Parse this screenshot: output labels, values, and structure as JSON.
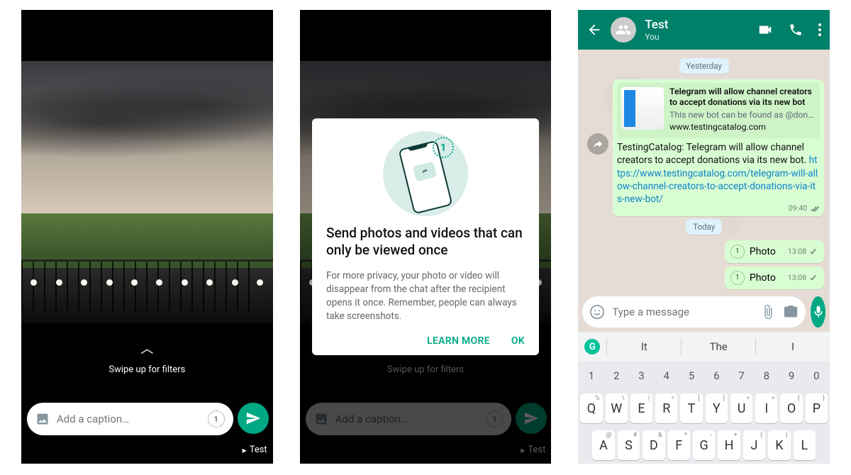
{
  "screen1": {
    "swipe_hint": "Swipe up for filters",
    "caption_placeholder": "Add a caption…",
    "view_once_glyph": "1",
    "recipient": "Test"
  },
  "screen2": {
    "swipe_hint": "Swipe up for filters",
    "caption_placeholder": "Add a caption…",
    "view_once_glyph": "1",
    "recipient": "Test",
    "dialog": {
      "one_glyph": "1",
      "title": "Send photos and videos that can only be viewed once",
      "body": "For more privacy, your photo or video will disappear from the chat after the recipient opens it once. Remember, people can always take screenshots.",
      "learn_more": "LEARN MORE",
      "ok": "OK"
    }
  },
  "screen3": {
    "header": {
      "title": "Test",
      "subtitle": "You"
    },
    "chips": {
      "yesterday": "Yesterday",
      "today": "Today"
    },
    "linked": {
      "card_title": "Telegram will allow channel creators to accept donations via its new bot",
      "card_desc": "This new bot can be found as @don…",
      "card_site": "www.testingcatalog.com",
      "body_text": "TestingCatalog: Telegram will allow channel creators to accept donations via its new bot. ",
      "body_link": "https://www.testingcatalog.com/telegram-will-allow-channel-creators-to-accept-donations-via-its-new-bot/",
      "time": "09:40"
    },
    "photo_msgs": [
      {
        "label": "Photo",
        "time": "13:08"
      },
      {
        "label": "Photo",
        "time": "13:08"
      }
    ],
    "input_placeholder": "Type a message",
    "keyboard": {
      "suggestions": [
        "It",
        "The",
        "I"
      ],
      "num_row": [
        "1",
        "2",
        "3",
        "4",
        "5",
        "6",
        "7",
        "8",
        "9",
        "0"
      ],
      "row1": [
        "Q",
        "W",
        "E",
        "R",
        "T",
        "Y",
        "U",
        "I",
        "O",
        "P"
      ],
      "row1_sup": [
        "%",
        "\\",
        "|",
        "=",
        "[",
        "]",
        "<",
        ">",
        "{",
        "}"
      ],
      "row2": [
        "A",
        "S",
        "D",
        "F",
        "G",
        "H",
        "J",
        "K",
        "L"
      ],
      "row2_sup": [
        "@",
        "#",
        "&",
        "*",
        "-",
        "+",
        "(",
        ")",
        ""
      ]
    }
  }
}
